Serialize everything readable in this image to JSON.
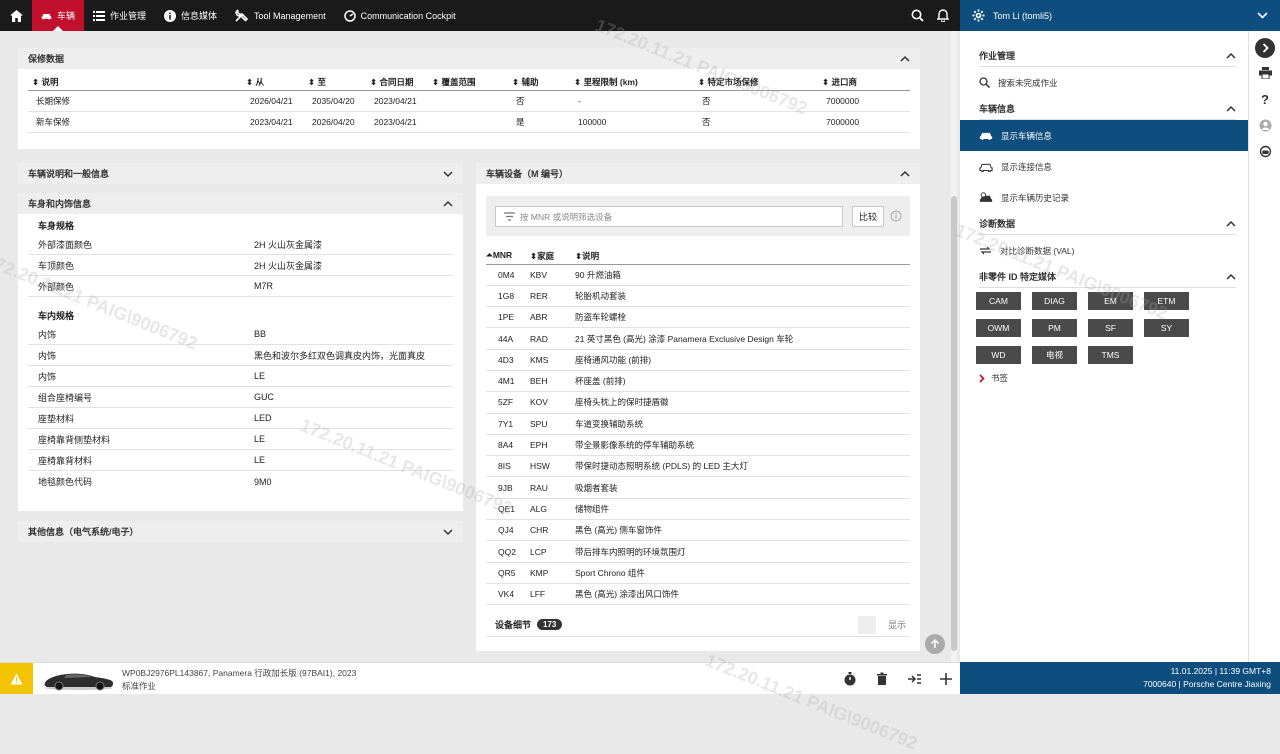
{
  "topbar": {
    "active_tab": "车辆",
    "items": [
      "作业管理",
      "信息媒体",
      "Tool Management",
      "Communication Cockpit"
    ]
  },
  "user": {
    "name": "Tom Li (tomli5)"
  },
  "warranty": {
    "title": "保修数据",
    "columns": [
      "说明",
      "从",
      "至",
      "合同日期",
      "覆盖范围",
      "辅助",
      "里程限制 (km)",
      "特定市场保修",
      "进口商"
    ],
    "rows": [
      [
        "长期保修",
        "2026/04/21",
        "2035/04/20",
        "2023/04/21",
        "",
        "否",
        "-",
        "否",
        "7000000"
      ],
      [
        "新车保修",
        "2023/04/21",
        "2026/04/20",
        "2023/04/21",
        "",
        "是",
        "100000",
        "否",
        "7000000"
      ]
    ]
  },
  "vehicle_desc": {
    "title": "车辆说明和一般信息"
  },
  "body_info": {
    "title": "车身和内饰信息",
    "groups": [
      {
        "title": "车身规格",
        "rows": [
          [
            "外部漆面颜色",
            "2H 火山灰金属漆"
          ],
          [
            "车顶颜色",
            "2H 火山灰金属漆"
          ],
          [
            "外部颜色",
            "M7R"
          ]
        ]
      },
      {
        "title": "车内规格",
        "rows": [
          [
            "内饰",
            "BB"
          ],
          [
            "内饰",
            "黑色和波尔多红双色调真皮内饰，光面真皮"
          ],
          [
            "内饰",
            "LE"
          ],
          [
            "组合座椅编号",
            "GUC"
          ],
          [
            "座垫材料",
            "LED"
          ],
          [
            "座椅靠背侧垫材料",
            "LE"
          ],
          [
            "座椅靠背材料",
            "LE"
          ],
          [
            "地毯颜色代码",
            "9M0"
          ]
        ]
      }
    ]
  },
  "other_info": {
    "title": "其他信息（电气系统/电子）"
  },
  "equipment": {
    "title": "车辆设备（M 编号）",
    "search_placeholder": "按 MNR 或说明筛选设备",
    "compare_label": "比较",
    "columns": [
      "MNR",
      "家庭",
      "说明"
    ],
    "rows": [
      [
        "0M4",
        "KBV",
        "90 升燃油箱"
      ],
      [
        "1G8",
        "RER",
        "轮胎机动套装"
      ],
      [
        "1PE",
        "ABR",
        "防盗车轮螺栓"
      ],
      [
        "44A",
        "RAD",
        "21 英寸黑色 (高光) 涂漆 Panamera Exclusive Design 车轮"
      ],
      [
        "4D3",
        "KMS",
        "座椅通风功能 (前排)"
      ],
      [
        "4M1",
        "BEH",
        "杯座盖 (前排)"
      ],
      [
        "5ZF",
        "KOV",
        "座椅头枕上的保时捷盾徽"
      ],
      [
        "7Y1",
        "SPU",
        "车道变换辅助系统"
      ],
      [
        "8A4",
        "EPH",
        "带全景影像系统的停车辅助系统"
      ],
      [
        "8IS",
        "HSW",
        "带保时捷动态照明系统 (PDLS) 的 LED 主大灯"
      ],
      [
        "9JB",
        "RAU",
        "吸烟者套装"
      ],
      [
        "QE1",
        "ALG",
        "储物组件"
      ],
      [
        "QJ4",
        "CHR",
        "黑色 (高光) 侧车窗饰件"
      ],
      [
        "QQ2",
        "LCP",
        "带后排车内照明的环境氛围灯"
      ],
      [
        "QR5",
        "KMP",
        "Sport Chrono 组件"
      ],
      [
        "VK4",
        "LFF",
        "黑色 (高光) 涂漆出风口饰件"
      ]
    ],
    "detail_label": "设备细节",
    "detail_count": "173",
    "show_label": "显示"
  },
  "sidebar": {
    "job": {
      "title": "作业管理",
      "items": [
        "搜索未完成作业"
      ]
    },
    "vehicle": {
      "title": "车辆信息",
      "items": [
        "显示车辆信息",
        "显示连接信息",
        "显示车辆历史记录"
      ]
    },
    "diag": {
      "title": "诊断数据",
      "items": [
        "对比诊断数据 (VAL)"
      ]
    },
    "parts": {
      "title": "非零件 ID 特定媒体",
      "chips": [
        "CAM",
        "DIAG",
        "EM",
        "ETM",
        "OWM",
        "PM",
        "SF",
        "SY",
        "WD",
        "电视",
        "TMS"
      ],
      "bookmark": "书签"
    }
  },
  "bottom": {
    "vehicle_line": "WP0BJ2976PL143867, Panamera 行政加长版 (97BAI1), 2023",
    "job_type": "标准作业",
    "datetime": "11.01.2025 | 11:39 GMT+8",
    "dealer": "7000640 | Porsche Centre Jiaxing"
  },
  "watermark": "172.20.11.21 PAIG\\9006792",
  "colors": {
    "topbar": "#1a1a1a",
    "active_tab": "#c0102e",
    "brand_blue": "#0e4e7e",
    "warning": "#f5c400"
  }
}
